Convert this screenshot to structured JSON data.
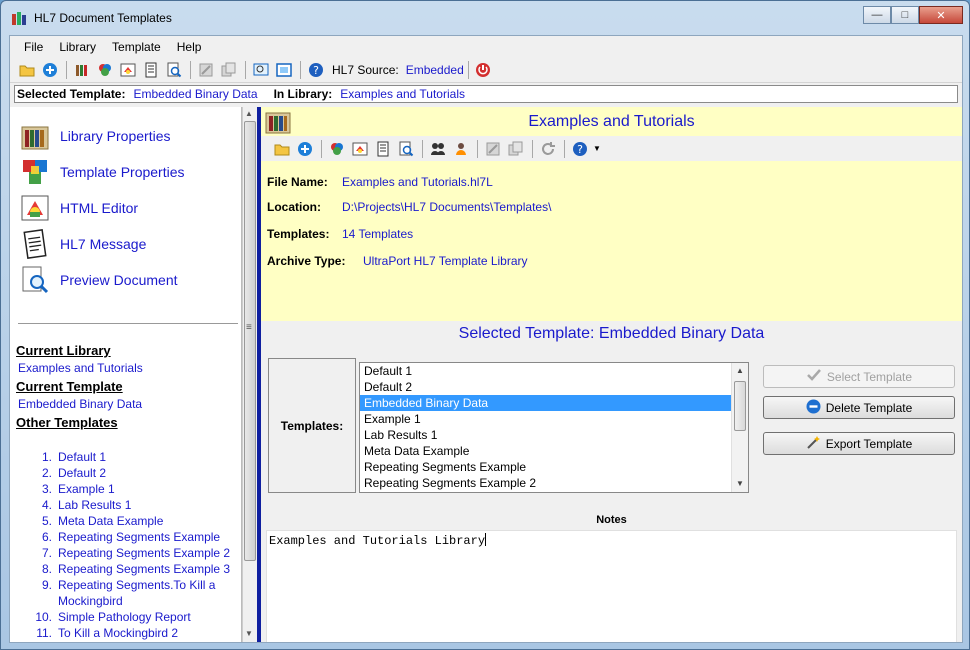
{
  "window": {
    "title": "HL7 Document Templates"
  },
  "menu": [
    "File",
    "Library",
    "Template",
    "Help"
  ],
  "toolbar": {
    "source_label": "HL7 Source:",
    "source_value": "Embedded"
  },
  "selection_bar": {
    "template_label": "Selected Template:",
    "template_value": "Embedded Binary Data",
    "library_label": "In Library:",
    "library_value": "Examples and Tutorials"
  },
  "left_nav": [
    {
      "label": "Library Properties",
      "icon": "books-icon"
    },
    {
      "label": "Template Properties",
      "icon": "cubes-icon"
    },
    {
      "label": "HTML Editor",
      "icon": "html-editor-icon"
    },
    {
      "label": "HL7 Message",
      "icon": "message-icon"
    },
    {
      "label": "Preview Document",
      "icon": "preview-icon"
    }
  ],
  "left_info": {
    "current_library_heading": "Current Library",
    "current_library": "Examples and Tutorials",
    "current_template_heading": "Current Template",
    "current_template": "Embedded Binary Data",
    "other_templates_heading": "Other Templates",
    "other_templates": [
      {
        "num": "1.",
        "name": "Default 1"
      },
      {
        "num": "2.",
        "name": "Default 2"
      },
      {
        "num": "3.",
        "name": "Example 1"
      },
      {
        "num": "4.",
        "name": "Lab Results 1"
      },
      {
        "num": "5.",
        "name": "Meta Data Example"
      },
      {
        "num": "6.",
        "name": "Repeating Segments Example"
      },
      {
        "num": "7.",
        "name": "Repeating Segments Example 2"
      },
      {
        "num": "8.",
        "name": "Repeating Segments Example 3"
      },
      {
        "num": "9.",
        "name": "Repeating Segments.To Kill a Mockingbird"
      },
      {
        "num": "10.",
        "name": "Simple Pathology Report"
      },
      {
        "num": "11.",
        "name": "To Kill a Mockingbird 2"
      }
    ]
  },
  "library": {
    "title": "Examples and Tutorials",
    "file_name_label": "File Name:",
    "file_name": "Examples and Tutorials.hl7L",
    "location_label": "Location:",
    "location": "D:\\Projects\\HL7 Documents\\Templates\\",
    "templates_label": "Templates:",
    "templates_count": "14 Templates",
    "archive_label": "Archive Type:",
    "archive_type": "UltraPort HL7 Template Library"
  },
  "selected_template_title": "Selected Template: Embedded Binary Data",
  "templates_box_label": "Templates:",
  "templates_list": [
    {
      "name": "Default 1",
      "selected": false
    },
    {
      "name": "Default 2",
      "selected": false
    },
    {
      "name": "Embedded Binary Data",
      "selected": true
    },
    {
      "name": "Example 1",
      "selected": false
    },
    {
      "name": "Lab Results 1",
      "selected": false
    },
    {
      "name": "Meta Data Example",
      "selected": false
    },
    {
      "name": "Repeating Segments Example",
      "selected": false
    },
    {
      "name": "Repeating Segments Example 2",
      "selected": false
    }
  ],
  "buttons": {
    "select": "Select Template",
    "delete": "Delete Template",
    "export": "Export Template"
  },
  "notes": {
    "heading": "Notes",
    "text": "Examples and Tutorials Library"
  },
  "colors": {
    "link_blue": "#1a1acc",
    "info_yellow": "#ffffc4",
    "splitter_blue": "#0f1fa0",
    "selection_blue": "#3399ff"
  }
}
